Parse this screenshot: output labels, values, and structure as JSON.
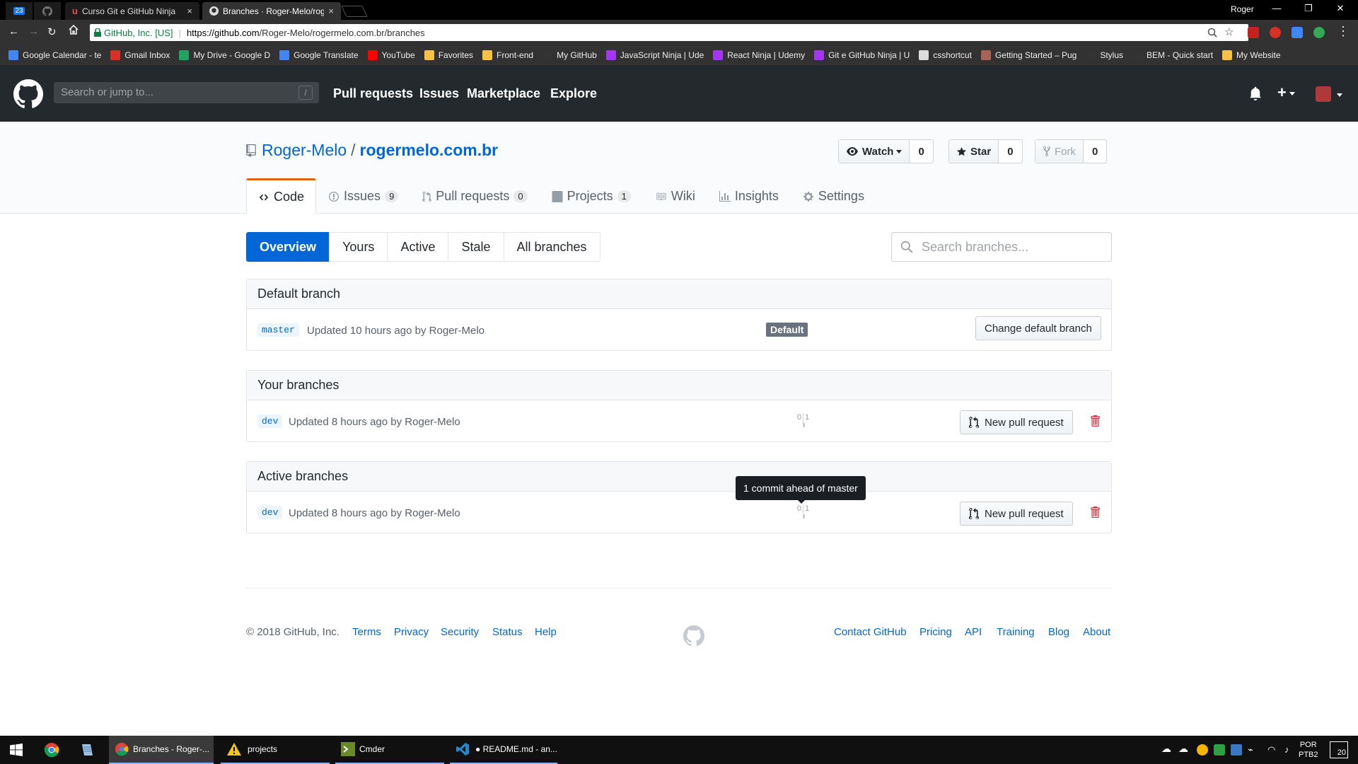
{
  "browser": {
    "pinned_tab_badge": "23",
    "tabs": [
      {
        "title": "Curso Git e GitHub Ninja"
      },
      {
        "title": "Branches · Roger-Melo/rogermelo.com.br"
      }
    ],
    "tab_close": "×",
    "profile_name": "Roger",
    "security_label": "GitHub, Inc. [US]",
    "url_host": "https://github.com",
    "url_path": "/Roger-Melo/rogermelo.com.br/branches",
    "bookmarks": [
      {
        "label": "Google Calendar - te",
        "color": "#4285f4"
      },
      {
        "label": "Gmail Inbox",
        "color": "#d93025"
      },
      {
        "label": "My Drive - Google D",
        "color": "#1fa463"
      },
      {
        "label": "Google Translate",
        "color": "#4285f4"
      },
      {
        "label": "YouTube",
        "color": "#ff0000"
      },
      {
        "label": "Favorites",
        "color": "#f6c144"
      },
      {
        "label": "Front-end",
        "color": "#f6c144"
      },
      {
        "label": "My GitHub",
        "color": "#333333"
      },
      {
        "label": "JavaScript Ninja | Ude",
        "color": "#a435f0"
      },
      {
        "label": "React Ninja | Udemy",
        "color": "#a435f0"
      },
      {
        "label": "Git e GitHub Ninja | U",
        "color": "#a435f0"
      },
      {
        "label": "csshortcut",
        "color": "#dddddd"
      },
      {
        "label": "Getting Started – Pug",
        "color": "#a86454"
      },
      {
        "label": "Stylus",
        "color": "#333333"
      },
      {
        "label": "BEM - Quick start",
        "color": "#333333"
      },
      {
        "label": "My Website",
        "color": "#f6c144"
      }
    ]
  },
  "github": {
    "search_placeholder": "Search or jump to...",
    "search_key": "/",
    "nav": [
      "Pull requests",
      "Issues",
      "Marketplace",
      "Explore"
    ],
    "plus": "+"
  },
  "repo": {
    "owner": "Roger-Melo",
    "separator": "/",
    "name": "rogermelo.com.br",
    "watch_label": "Watch",
    "watch_count": "0",
    "star_label": "Star",
    "star_count": "0",
    "fork_label": "Fork",
    "fork_count": "0",
    "tabs": [
      {
        "label": "Code"
      },
      {
        "label": "Issues",
        "count": "9"
      },
      {
        "label": "Pull requests",
        "count": "0"
      },
      {
        "label": "Projects",
        "count": "1"
      },
      {
        "label": "Wiki"
      },
      {
        "label": "Insights"
      },
      {
        "label": "Settings"
      }
    ]
  },
  "branches": {
    "filters": [
      "Overview",
      "Yours",
      "Active",
      "Stale",
      "All branches"
    ],
    "search_placeholder": "Search branches...",
    "default_section": {
      "title": "Default branch",
      "branch": "master",
      "updated_text": "Updated 10 hours ago by",
      "author": "Roger-Melo",
      "badge": "Default",
      "button": "Change default branch"
    },
    "your_section": {
      "title": "Your branches",
      "branch": "dev",
      "updated_text": "Updated 8 hours ago by",
      "author": "Roger-Melo",
      "behind": "0",
      "ahead": "1",
      "button": "New pull request"
    },
    "active_section": {
      "title": "Active branches",
      "branch": "dev",
      "updated_text": "Updated 8 hours ago by",
      "author": "Roger-Melo",
      "behind": "0",
      "ahead": "1",
      "button": "New pull request"
    },
    "tooltip": "1 commit ahead of master"
  },
  "footer": {
    "copyright": "© 2018 GitHub, Inc.",
    "left_links": [
      "Terms",
      "Privacy",
      "Security",
      "Status",
      "Help"
    ],
    "right_links": [
      "Contact GitHub",
      "Pricing",
      "API",
      "Training",
      "Blog",
      "About"
    ]
  },
  "taskbar": {
    "apps": [
      {
        "label": "Branches - Roger-..."
      },
      {
        "label": "projects"
      },
      {
        "label": "Cmder"
      },
      {
        "label": "● README.md - an..."
      }
    ],
    "lang_line1": "POR",
    "lang_line2": "PTB2",
    "notification_count": "20"
  },
  "colors": {
    "github_header": "#24292e",
    "link_blue": "#0366d6",
    "tab_accent": "#e36209",
    "danger_red": "#cb2431"
  }
}
